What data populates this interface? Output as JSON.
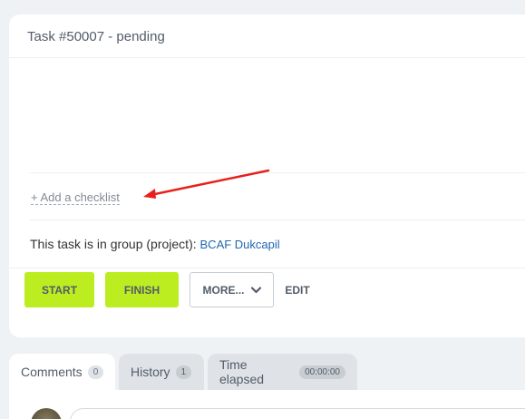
{
  "task": {
    "title": "Task #50007 - pending"
  },
  "checklist": {
    "add_label": "+ Add a checklist"
  },
  "group": {
    "prefix": "This task is in group (project):",
    "name": "BCAF Dukcapil"
  },
  "actions": {
    "start": "START",
    "finish": "FINISH",
    "more": "MORE...",
    "edit": "EDIT"
  },
  "tabs": [
    {
      "label": "Comments",
      "count": "0"
    },
    {
      "label": "History",
      "count": "1"
    },
    {
      "label": "Time elapsed",
      "count": "00:00:00"
    }
  ],
  "colors": {
    "accent_button": "#bbed21",
    "link": "#2067b0",
    "annotation_arrow": "#e8201c"
  },
  "icons": {
    "more_dropdown": "chevron-down-icon",
    "annotation": "red-arrow-icon"
  }
}
